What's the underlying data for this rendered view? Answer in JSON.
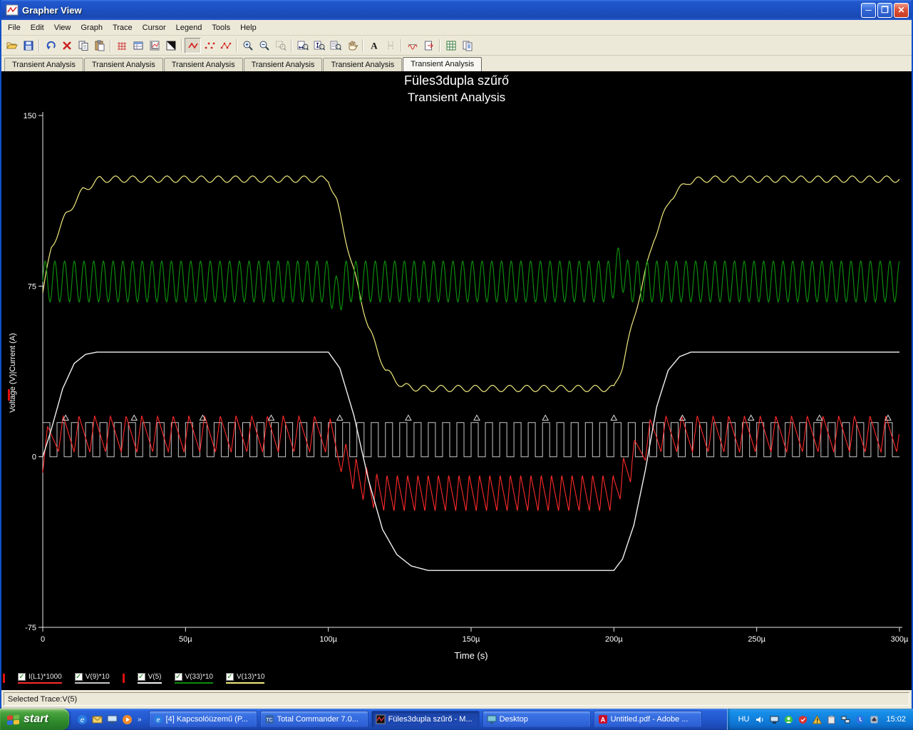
{
  "window": {
    "title": "Grapher View"
  },
  "menu": {
    "items": [
      "File",
      "Edit",
      "View",
      "Graph",
      "Trace",
      "Cursor",
      "Legend",
      "Tools",
      "Help"
    ]
  },
  "toolbar": {
    "icons": [
      "open",
      "save",
      "undo",
      "delete",
      "copy",
      "paste",
      "grid",
      "legend-table",
      "graph-properties",
      "invert-background",
      "trace-line",
      "trace-dots",
      "trace-line-dots",
      "zoom-in",
      "zoom-out",
      "zoom-window",
      "zoom-horizontal",
      "zoom-vertical",
      "zoom-restore",
      "hand",
      "text",
      "cursors",
      "overlay-traces",
      "export-graph",
      "export-excel",
      "copy-pages"
    ]
  },
  "tabs": {
    "items": [
      "Transient Analysis",
      "Transient Analysis",
      "Transient Analysis",
      "Transient Analysis",
      "Transient Analysis",
      "Transient Analysis"
    ],
    "active_index": 5
  },
  "chart_data": {
    "type": "line",
    "title": "Füles3dupla szűrő",
    "subtitle": "Transient Analysis",
    "xlabel": "Time (s)",
    "ylabel": "Voltage (V)|Current (A)",
    "xlim": [
      0,
      300
    ],
    "x_unit": "µs",
    "ylim": [
      -75,
      150
    ],
    "grid": false,
    "background": "#000000",
    "x_ticks": [
      {
        "t": 0,
        "label": "0"
      },
      {
        "t": 50,
        "label": "50µ"
      },
      {
        "t": 100,
        "label": "100µ"
      },
      {
        "t": 150,
        "label": "150µ"
      },
      {
        "t": 200,
        "label": "200µ"
      },
      {
        "t": 250,
        "label": "250µ"
      },
      {
        "t": 300,
        "label": "300µ"
      }
    ],
    "y_ticks": [
      {
        "v": 150,
        "label": "150"
      },
      {
        "v": 75,
        "label": "75"
      },
      {
        "v": 0,
        "label": "0"
      },
      {
        "v": -75,
        "label": "-75"
      }
    ],
    "series": [
      {
        "name": "V(9)*10",
        "color": "#c8c8c8",
        "kind": "square",
        "low": 0,
        "high": 15,
        "period_us": 5,
        "duty": 0.5,
        "width": 1
      },
      {
        "name": "V(13)*10",
        "color": "#f0ea7d",
        "kind": "ripple",
        "width": 1.2,
        "ripple": {
          "amp": 1.4,
          "period_us": 6
        },
        "base": [
          [
            0,
            72
          ],
          [
            3,
            92
          ],
          [
            8,
            106
          ],
          [
            14,
            117
          ],
          [
            20,
            122
          ],
          [
            100,
            122
          ],
          [
            103,
            112
          ],
          [
            108,
            86
          ],
          [
            114,
            57
          ],
          [
            120,
            38
          ],
          [
            126,
            31
          ],
          [
            132,
            30
          ],
          [
            200,
            30
          ],
          [
            203,
            40
          ],
          [
            208,
            66
          ],
          [
            214,
            96
          ],
          [
            220,
            114
          ],
          [
            226,
            121
          ],
          [
            232,
            122
          ],
          [
            300,
            122
          ]
        ]
      },
      {
        "name": "V(33)*10",
        "color": "#0c8c0c",
        "kind": "ripple",
        "width": 1.2,
        "ripple": {
          "amp": 9,
          "period_us": 3.4
        },
        "base": [
          [
            0,
            77
          ],
          [
            100,
            77
          ],
          [
            103,
            70
          ],
          [
            106,
            77
          ],
          [
            199,
            77
          ],
          [
            202,
            84
          ],
          [
            205,
            77
          ],
          [
            300,
            77
          ]
        ]
      },
      {
        "name": "I(L1)*1000",
        "color": "#ff2a2a",
        "kind": "saw",
        "width": 1.1,
        "saw": {
          "amp": 8,
          "period_us": 5.5,
          "period2_us": 3.6,
          "rise": 0.3
        },
        "base": [
          [
            0,
            1
          ],
          [
            2,
            6
          ],
          [
            5,
            10
          ],
          [
            100,
            10
          ],
          [
            104,
            2
          ],
          [
            110,
            -9
          ],
          [
            116,
            -15
          ],
          [
            120,
            -16
          ],
          [
            200,
            -16
          ],
          [
            203,
            -9
          ],
          [
            208,
            1
          ],
          [
            212,
            8
          ],
          [
            215,
            10
          ],
          [
            300,
            10
          ]
        ]
      },
      {
        "name": "V(5)",
        "color": "#f2f2f2",
        "kind": "ripple",
        "width": 1.4,
        "ripple": {
          "amp": 0,
          "period_us": 1
        },
        "base": [
          [
            0,
            0
          ],
          [
            3,
            12
          ],
          [
            7,
            30
          ],
          [
            11,
            41
          ],
          [
            15,
            45
          ],
          [
            19,
            46
          ],
          [
            100,
            46
          ],
          [
            104,
            39
          ],
          [
            109,
            18
          ],
          [
            114,
            -10
          ],
          [
            119,
            -32
          ],
          [
            124,
            -43
          ],
          [
            129,
            -48
          ],
          [
            135,
            -50
          ],
          [
            200,
            -50
          ],
          [
            203,
            -45
          ],
          [
            207,
            -30
          ],
          [
            211,
            -6
          ],
          [
            215,
            22
          ],
          [
            219,
            38
          ],
          [
            223,
            44
          ],
          [
            227,
            46
          ],
          [
            300,
            46
          ]
        ]
      }
    ],
    "markers": {
      "shape": "triangle",
      "color": "#dddddd",
      "y": 17,
      "xs": [
        8,
        32,
        56,
        80,
        104,
        128,
        152,
        176,
        200,
        224,
        248,
        272,
        296
      ]
    }
  },
  "legend": {
    "items": [
      {
        "label": "I(L1)*1000",
        "color": "#ff2a2a",
        "checked": true,
        "selected": false
      },
      {
        "label": "V(9)*10",
        "color": "#c8c8c8",
        "checked": true,
        "selected": false
      },
      {
        "label": "V(5)",
        "color": "#f2f2f2",
        "checked": true,
        "selected": true
      },
      {
        "label": "V(33)*10",
        "color": "#0c8c0c",
        "checked": true,
        "selected": false
      },
      {
        "label": "V(13)*10",
        "color": "#f0ea7d",
        "checked": true,
        "selected": false
      }
    ],
    "check_glyph": "✓"
  },
  "status": {
    "text": "Selected Trace:V(5)"
  },
  "taskbar": {
    "start_label": "start",
    "buttons": [
      {
        "label": "[4] Kapcsolóüzemű (P...",
        "active": false
      },
      {
        "label": "Total Commander 7.0...",
        "active": false
      },
      {
        "label": "Füles3dupla szűrő - M...",
        "active": true
      },
      {
        "label": "Desktop",
        "active": false
      },
      {
        "label": "Untitled.pdf - Adobe ...",
        "active": false
      }
    ],
    "tray": {
      "language": "HU",
      "time": "15:02"
    }
  }
}
